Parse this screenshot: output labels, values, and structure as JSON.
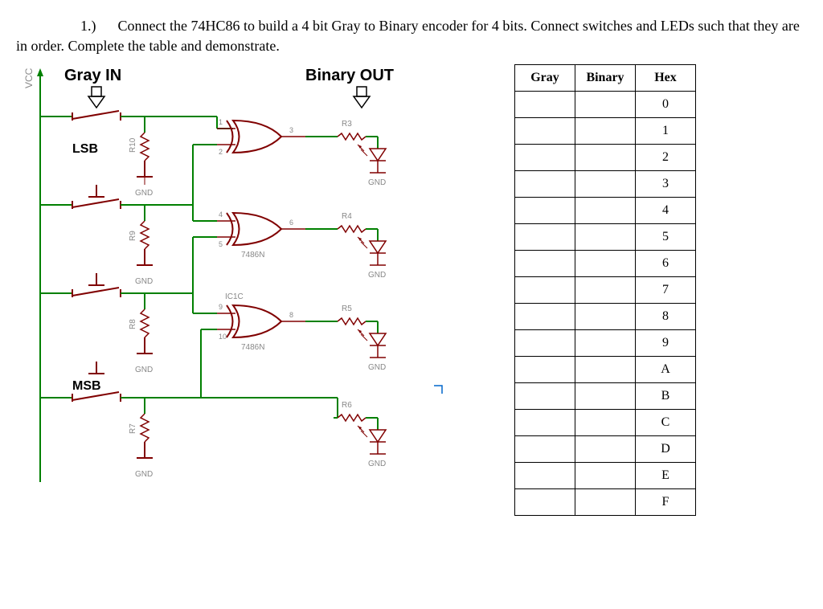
{
  "question": {
    "number": "1.)",
    "text": "Connect  the 74HC86  to build a 4 bit Gray to Binary encoder for 4 bits. Connect switches and LEDs such  that they are in order. Complete the table and demonstrate."
  },
  "labels": {
    "vcc": "VCC",
    "gray_in": "Gray IN",
    "binary_out": "Binary OUT",
    "lsb": "LSB",
    "msb": "MSB",
    "gnd": "GND",
    "ic_label": "7486N",
    "ic_c": "IC1C",
    "r3": "R3",
    "r4": "R4",
    "r5": "R5",
    "r6": "R6",
    "r7": "R7",
    "r8": "R8",
    "r9": "R9",
    "r10": "R10",
    "pins": {
      "p1": "1",
      "p2": "2",
      "p3": "3",
      "p4": "4",
      "p5": "5",
      "p6": "6",
      "p8": "8",
      "p9": "9",
      "p10": "10"
    }
  },
  "table": {
    "headers": [
      "Gray",
      "Binary",
      "Hex"
    ],
    "hex_values": [
      "0",
      "1",
      "2",
      "3",
      "4",
      "5",
      "6",
      "7",
      "8",
      "9",
      "A",
      "B",
      "C",
      "D",
      "E",
      "F"
    ]
  }
}
